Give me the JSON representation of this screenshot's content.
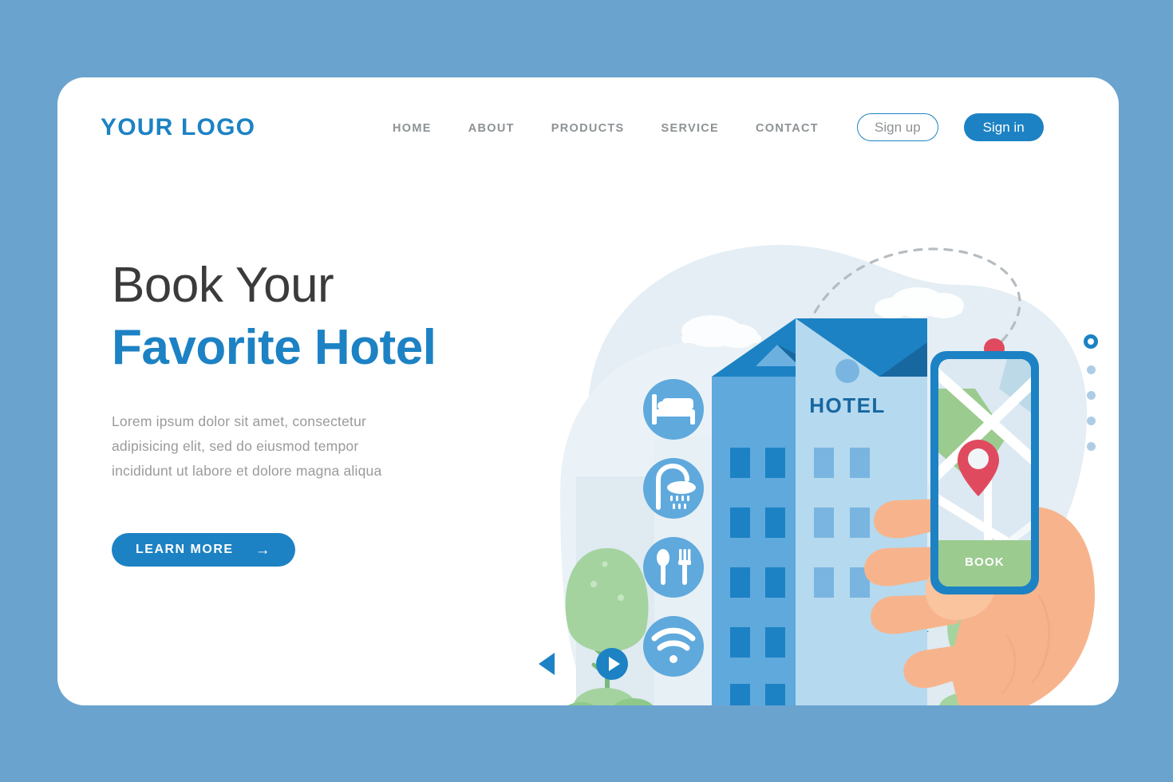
{
  "page": {
    "background_color": "#6ba3cf",
    "card_color": "#ffffff"
  },
  "header": {
    "logo": "YOUR LOGO",
    "nav": [
      {
        "label": "HOME"
      },
      {
        "label": "ABOUT"
      },
      {
        "label": "PRODUCTS"
      },
      {
        "label": "SERVICE"
      },
      {
        "label": "CONTACT"
      }
    ],
    "sign_up_label": "Sign up",
    "sign_in_label": "Sign in"
  },
  "hero": {
    "headline_line1": "Book Your",
    "headline_line2": "Favorite Hotel",
    "paragraph": "Lorem ipsum dolor sit amet, consectetur adipisicing elit, sed do eiusmod tempor incididunt ut labore et dolore magna aliqua",
    "cta_label": "LEARN MORE",
    "cta_arrow": "→"
  },
  "illustration": {
    "hotel_sign": "HOTEL",
    "phone_button_label": "BOOK",
    "amenities": [
      {
        "name": "bed-icon",
        "label": "Bed"
      },
      {
        "name": "shower-icon",
        "label": "Shower"
      },
      {
        "name": "restaurant-icon",
        "label": "Restaurant"
      },
      {
        "name": "wifi-icon",
        "label": "Wifi"
      }
    ]
  },
  "carousel": {
    "prev_label": "Previous slide",
    "next_label": "Next slide",
    "dots": [
      {
        "active": true
      },
      {
        "active": false
      },
      {
        "active": false
      },
      {
        "active": false
      },
      {
        "active": false
      }
    ]
  },
  "colors": {
    "accent_blue": "#1c82c4",
    "page_blue": "#6ba3cf",
    "text_gray": "#8d9295",
    "heading_dark": "#3b3b3b",
    "pin_red": "#e04a5f",
    "skin": "#f7b48c",
    "green": "#8ec98a"
  }
}
